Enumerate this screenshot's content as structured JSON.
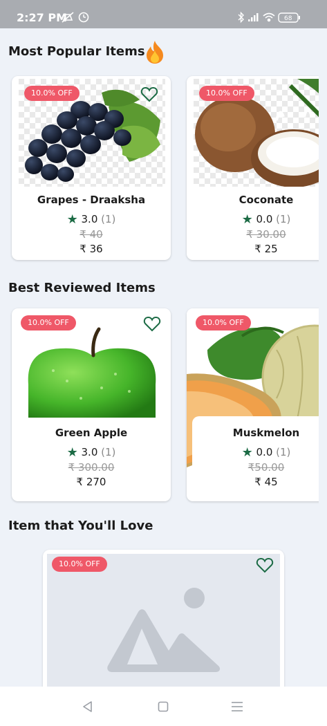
{
  "status_bar": {
    "time": "2:27 PM",
    "battery": "68"
  },
  "sections": {
    "popular": "Most Popular Items",
    "reviewed": "Best Reviewed Items",
    "love": "Item that You'll Love"
  },
  "popular_items": [
    {
      "discount": "10.0% OFF",
      "name": "Grapes - Draaksha",
      "rating": "3.0",
      "reviews": "(1)",
      "old_price": "₹ 40",
      "price": "₹ 36"
    },
    {
      "discount": "10.0% OFF",
      "name": "Coconate",
      "rating": "0.0",
      "reviews": "(1)",
      "old_price": "₹ 30.00",
      "price": "₹ 25"
    }
  ],
  "reviewed_items": [
    {
      "discount": "10.0% OFF",
      "name": "Green Apple",
      "rating": "3.0",
      "reviews": "(1)",
      "old_price": "₹ 300.00",
      "price": "₹ 270"
    },
    {
      "discount": "10.0% OFF",
      "name": "Muskmelon",
      "rating": "0.0",
      "reviews": "(1)",
      "old_price": "₹50.00",
      "price": "₹ 45"
    }
  ],
  "love_item": {
    "discount": "10.0% OFF"
  },
  "colors": {
    "accent": "#1c6b45",
    "badge": "#ef5868",
    "background": "#eef2f8"
  }
}
